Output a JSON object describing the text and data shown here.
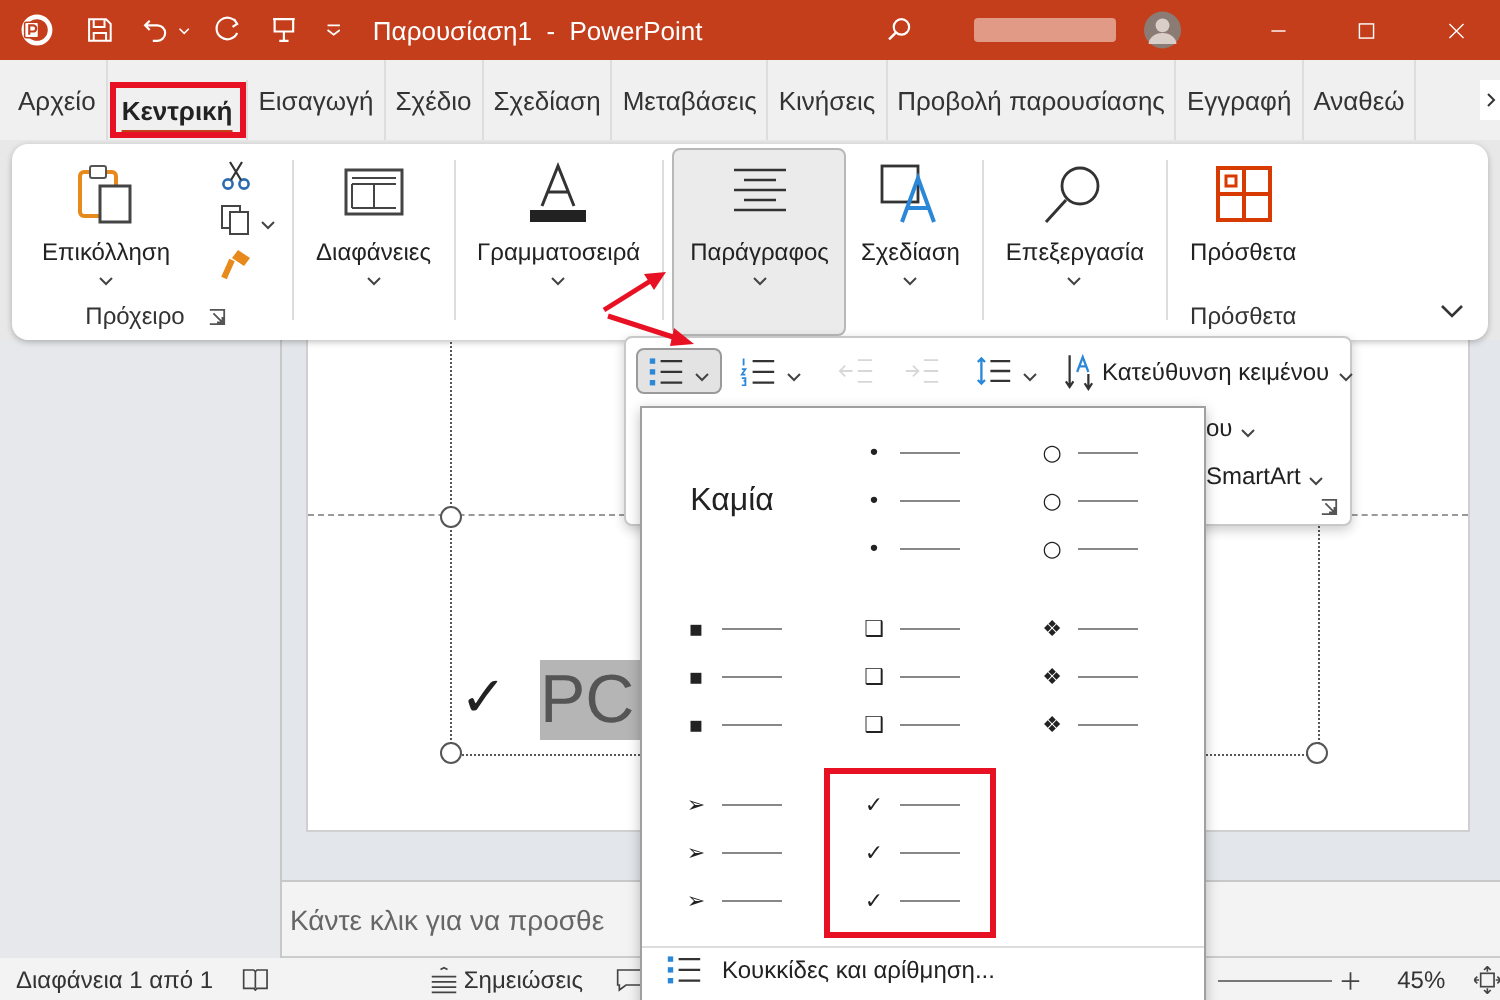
{
  "title_bar": {
    "title": "Παρουσίαση1  -  PowerPoint"
  },
  "tabs": [
    {
      "label": "Αρχείο",
      "selected": false,
      "highlighted": false
    },
    {
      "label": "Κεντρική",
      "selected": true,
      "highlighted": true
    },
    {
      "label": "Εισαγωγή",
      "selected": false,
      "highlighted": false
    },
    {
      "label": "Σχέδιο",
      "selected": false,
      "highlighted": false
    },
    {
      "label": "Σχεδίαση",
      "selected": false,
      "highlighted": false
    },
    {
      "label": "Μεταβάσεις",
      "selected": false,
      "highlighted": false
    },
    {
      "label": "Κινήσεις",
      "selected": false,
      "highlighted": false
    },
    {
      "label": "Προβολή παρουσίασης",
      "selected": false,
      "highlighted": false
    },
    {
      "label": "Εγγραφή",
      "selected": false,
      "highlighted": false
    },
    {
      "label": "Αναθεώ",
      "selected": false,
      "highlighted": false
    }
  ],
  "ribbon": {
    "groups": [
      {
        "kind": "paste",
        "label": "Επικόλληση",
        "caption": "Πρόχειρο",
        "pressed": false,
        "dropdown": true
      },
      {
        "kind": "slides",
        "label": "Διαφάνειες",
        "pressed": false,
        "dropdown": true
      },
      {
        "kind": "font",
        "label": "Γραμματοσειρά",
        "pressed": false,
        "dropdown": true
      },
      {
        "kind": "paragraph",
        "label": "Παράγραφος",
        "pressed": true,
        "dropdown": true
      },
      {
        "kind": "designer",
        "label": "Σχεδίαση",
        "pressed": false,
        "dropdown": true
      },
      {
        "kind": "editing",
        "label": "Επεξεργασία",
        "pressed": false,
        "dropdown": true
      },
      {
        "kind": "addins",
        "label": "Πρόσθετα",
        "caption": "Πρόσθετα",
        "pressed": false,
        "dropdown": false
      }
    ]
  },
  "paragraph_toolbar": {
    "tools": [
      {
        "kind": "bullets",
        "pressed": true,
        "disabled": false,
        "dropdown": true
      },
      {
        "kind": "numbering",
        "pressed": false,
        "disabled": false,
        "dropdown": true
      },
      {
        "kind": "outdent",
        "pressed": false,
        "disabled": true,
        "dropdown": false
      },
      {
        "kind": "indent",
        "pressed": false,
        "disabled": true,
        "dropdown": false
      },
      {
        "kind": "spacing",
        "pressed": false,
        "disabled": false,
        "dropdown": true
      }
    ],
    "commands": [
      "Κατεύθυνση κειμένου",
      "ου",
      "SmartArt"
    ]
  },
  "bullets_menu": {
    "options": [
      {
        "kind": "none",
        "label": "Καμία",
        "highlighted": false
      },
      {
        "kind": "bullet",
        "glyphs": [
          "•",
          "•",
          "•"
        ],
        "highlighted": false
      },
      {
        "kind": "bullet",
        "glyphs": [
          "○",
          "○",
          "○"
        ],
        "highlighted": false
      },
      {
        "kind": "bullet",
        "glyphs": [
          "▪",
          "▪",
          "▪"
        ],
        "highlighted": false
      },
      {
        "kind": "bullet",
        "glyphs": [
          "❑",
          "❑",
          "❑"
        ],
        "highlighted": false
      },
      {
        "kind": "bullet",
        "glyphs": [
          "❖",
          "❖",
          "❖"
        ],
        "highlighted": false
      },
      {
        "kind": "bullet",
        "glyphs": [
          "➢",
          "➢",
          "➢"
        ],
        "highlighted": false
      },
      {
        "kind": "bullet",
        "glyphs": [
          "✓",
          "✓",
          "✓"
        ],
        "highlighted": true
      }
    ],
    "footer": "Κουκκίδες και αρίθμηση..."
  },
  "slide": {
    "bullet": "✓",
    "text": "PC"
  },
  "notes": {
    "text": "Κάντε κλικ για να προσθε"
  },
  "status_bar": {
    "slide_count": "Διαφάνεια 1 από 1",
    "notes": "Σημειώσεις",
    "zoom": "45%"
  }
}
